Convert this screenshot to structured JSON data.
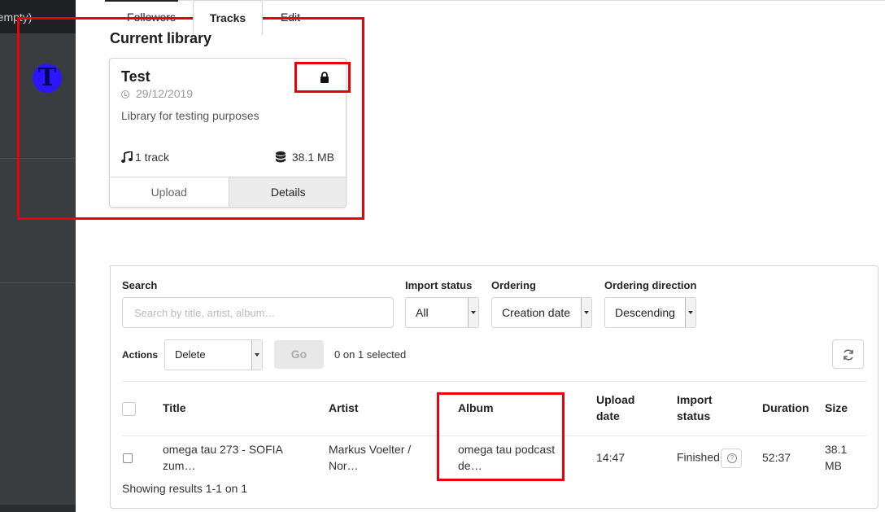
{
  "sidebar": {
    "top_text": "(empty)",
    "avatar_letter": "T"
  },
  "library": {
    "section_title": "Current library",
    "name": "Test",
    "date": "29/12/2019",
    "description": "Library for testing purposes",
    "tracks": "1 track",
    "size": "38.1 MB",
    "upload_label": "Upload",
    "details_label": "Details"
  },
  "tabs": {
    "followers": "Followers",
    "tracks": "Tracks",
    "edit": "Edit"
  },
  "filters": {
    "search_label": "Search",
    "search_placeholder": "Search by title, artist, album…",
    "import_status_label": "Import status",
    "import_status_value": "All",
    "ordering_label": "Ordering",
    "ordering_value": "Creation date",
    "direction_label": "Ordering direction",
    "direction_value": "Descending"
  },
  "actions": {
    "label": "Actions",
    "action_value": "Delete",
    "go_label": "Go",
    "selected_text": "0 on 1 selected"
  },
  "table": {
    "headers": {
      "title": "Title",
      "artist": "Artist",
      "album": "Album",
      "upload_line1": "Upload",
      "upload_line2": "date",
      "import_line1": "Import",
      "import_line2": "status",
      "duration": "Duration",
      "size": "Size"
    },
    "rows": [
      {
        "title_line1": "omega tau 273 - SOFIA",
        "title_line2": "zum…",
        "artist_line1": "Markus Voelter /",
        "artist_line2": "Nor…",
        "album_line1": "omega tau podcast",
        "album_line2": "de…",
        "upload_date": "14:47",
        "import_status": "Finished",
        "duration": "52:37",
        "size_line1": "38.1",
        "size_line2": "MB"
      }
    ],
    "footer": "Showing results 1-1 on 1"
  },
  "colors": {
    "highlight": "#e8000b",
    "avatar": "#2b16ff",
    "sidebar": "#3a3d40"
  }
}
